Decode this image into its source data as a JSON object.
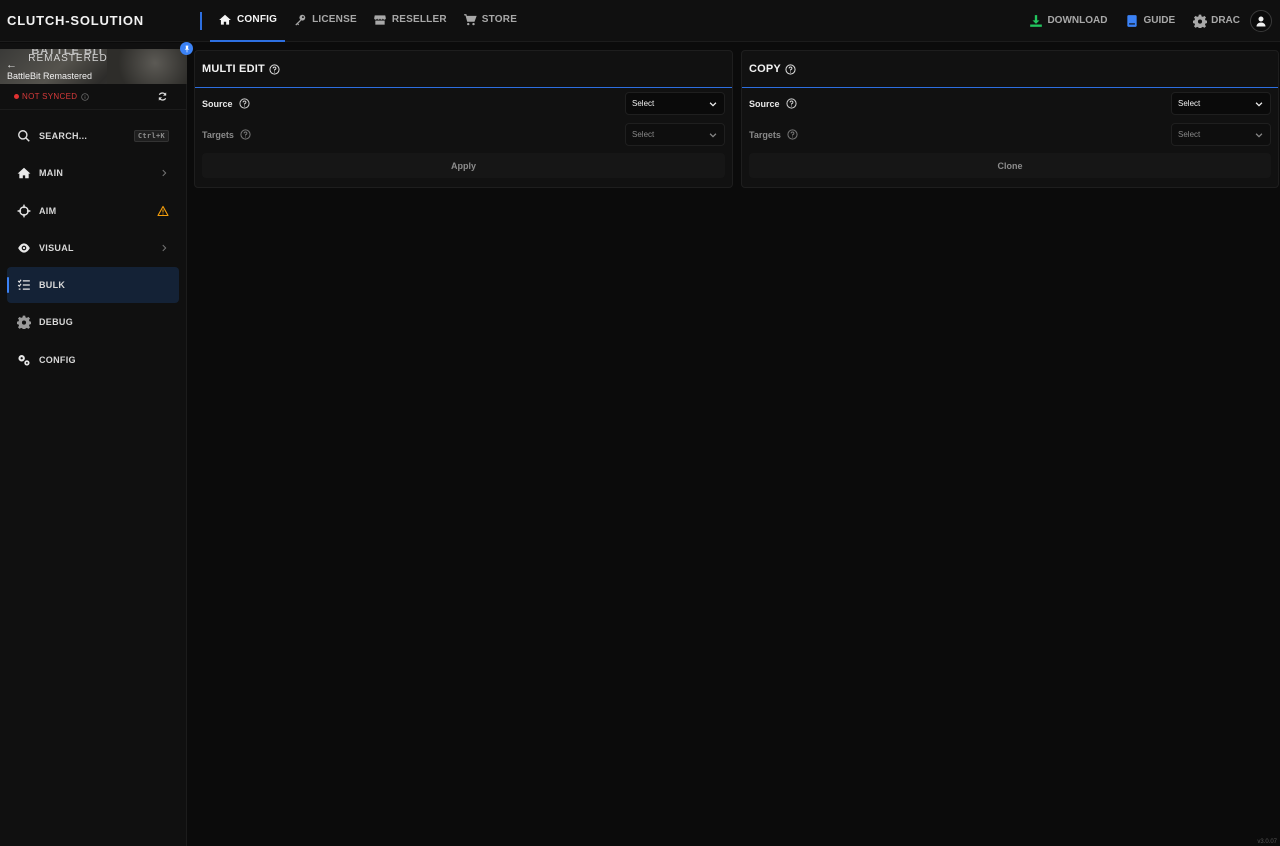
{
  "brand": "CLUTCH-SOLUTION",
  "nav": [
    {
      "label": "CONFIG",
      "icon": "home-icon",
      "active": true
    },
    {
      "label": "LICENSE",
      "icon": "key-icon"
    },
    {
      "label": "RESELLER",
      "icon": "store-icon"
    },
    {
      "label": "STORE",
      "icon": "cart-icon"
    }
  ],
  "top_right": {
    "download": "DOWNLOAD",
    "guide": "GUIDE",
    "user": "DRAC"
  },
  "colors": {
    "accent": "#3b82f6",
    "download_icon": "#22c55e",
    "guide_icon": "#3b82f6",
    "warning": "#f59e0b",
    "not_synced": "#e03131"
  },
  "game": {
    "logo_top": "BATTLE BIT",
    "logo_sub": "REMASTERED",
    "name": "BattleBit Remastered"
  },
  "sync": {
    "status": "NOT SYNCED"
  },
  "sidebar": {
    "search_label": "SEARCH...",
    "search_shortcut": "Ctrl+K",
    "items": [
      {
        "label": "MAIN",
        "icon": "home-icon",
        "right": "chevron-right-icon"
      },
      {
        "label": "AIM",
        "icon": "crosshair-icon",
        "right": "warning-icon"
      },
      {
        "label": "VISUAL",
        "icon": "eye-icon",
        "right": "chevron-right-icon"
      },
      {
        "label": "BULK",
        "icon": "checklist-icon",
        "active": true
      },
      {
        "label": "DEBUG",
        "icon": "gear-icon"
      },
      {
        "label": "CONFIG",
        "icon": "gears-icon"
      }
    ]
  },
  "multi_edit": {
    "title": "MULTI EDIT",
    "source_label": "Source",
    "source_value": "Select",
    "targets_label": "Targets",
    "targets_value": "Select",
    "action": "Apply"
  },
  "copy": {
    "title": "COPY",
    "source_label": "Source",
    "source_value": "Select",
    "targets_label": "Targets",
    "targets_value": "Select",
    "action": "Clone"
  },
  "version": "v3.0.07"
}
